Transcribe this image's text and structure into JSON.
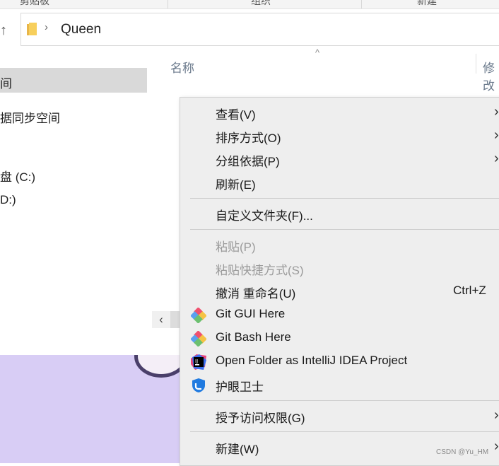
{
  "ribbon": {
    "tabs": [
      "剪贴板",
      "组织",
      "新建"
    ]
  },
  "address": {
    "path": "Queen"
  },
  "nav": {
    "items": [
      {
        "label": "间",
        "selected": true
      },
      {
        "label": "据同步空间"
      },
      {
        "label": "盘 (C:)"
      },
      {
        "label": "D:)"
      }
    ]
  },
  "columns": {
    "name": "名称",
    "modified": "修改"
  },
  "context_menu": {
    "items": [
      {
        "label": "查看(V)",
        "submenu": true
      },
      {
        "label": "排序方式(O)",
        "submenu": true
      },
      {
        "label": "分组依据(P)",
        "submenu": true
      },
      {
        "label": "刷新(E)"
      },
      {
        "label": "自定义文件夹(F)..."
      },
      {
        "label": "粘贴(P)",
        "disabled": true
      },
      {
        "label": "粘贴快捷方式(S)",
        "disabled": true
      },
      {
        "label": "撤消 重命名(U)",
        "shortcut": "Ctrl+Z"
      },
      {
        "label": "Git GUI Here",
        "icon": "git-gui-icon"
      },
      {
        "label": "Git Bash Here",
        "icon": "git-bash-icon"
      },
      {
        "label": "Open Folder as IntelliJ IDEA Project",
        "icon": "intellij-icon"
      },
      {
        "label": "护眼卫士",
        "icon": "eye-guard-icon"
      },
      {
        "label": "授予访问权限(G)",
        "submenu": true
      },
      {
        "label": "新建(W)",
        "submenu": true
      }
    ]
  },
  "watermark": "CSDN @Yu_HM",
  "colors": {
    "menu_bg": "#eeeeee",
    "selected_nav": "#d9d9d9",
    "purple": "#d8cdf5"
  }
}
